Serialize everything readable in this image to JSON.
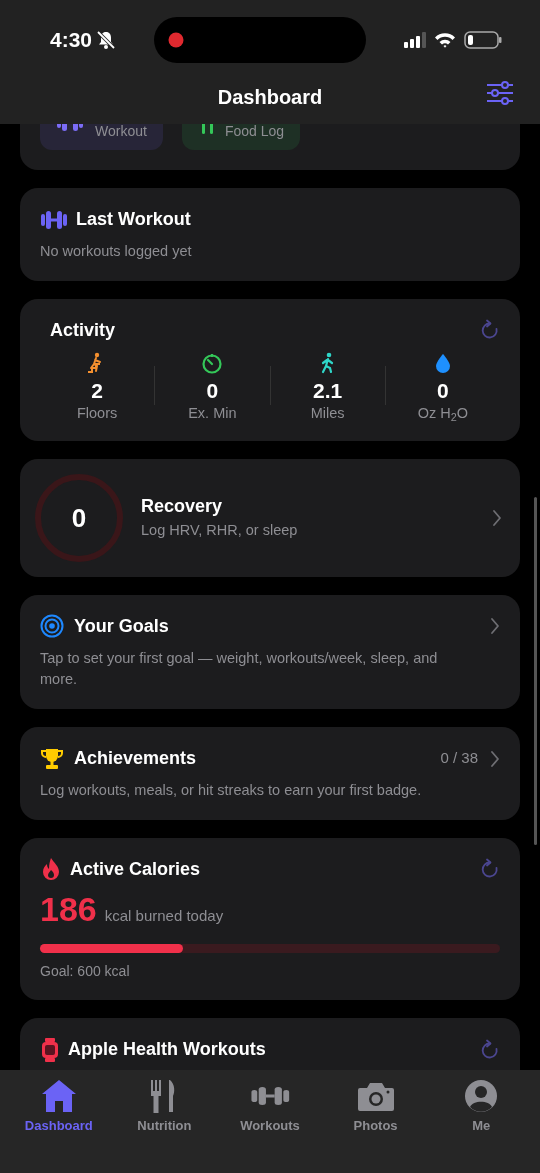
{
  "status_bar": {
    "time": "4:30"
  },
  "header": {
    "title": "Dashboard"
  },
  "quick_actions": [
    {
      "label": "Workout",
      "kind": "workout"
    },
    {
      "label": "Food Log",
      "kind": "food"
    }
  ],
  "last_workout": {
    "title": "Last Workout",
    "message": "No workouts logged yet"
  },
  "activity": {
    "title": "Activity",
    "stats": [
      {
        "kind": "floors",
        "value": "2",
        "label": "Floors"
      },
      {
        "kind": "exercise",
        "value": "0",
        "label": "Ex. Min"
      },
      {
        "kind": "distance",
        "value": "2.1",
        "label": "Miles"
      },
      {
        "kind": "water",
        "value": "0",
        "label": "Oz H$_{2}$O"
      }
    ]
  },
  "recovery": {
    "score": "0",
    "title": "Recovery",
    "subtitle": "Log HRV, RHR, or sleep"
  },
  "goals": {
    "title": "Your Goals",
    "text": "Tap to set your first goal — weight, workouts/week, sleep, and more."
  },
  "achievements": {
    "title": "Achievements",
    "progress": "0 / 38",
    "text": "Log workouts, meals, or hit streaks to earn your first badge."
  },
  "active_calories": {
    "title": "Active Calories",
    "value": "186",
    "unit": "kcal burned today",
    "level": 0.31,
    "goal": "Goal: 600 kcal"
  },
  "health_workouts": {
    "title": "Apple Health Workouts"
  },
  "tab_bar": {
    "tabs": [
      {
        "label": "Dashboard",
        "kind": "home",
        "selected": true
      },
      {
        "label": "Nutrition",
        "kind": "nutrition",
        "selected": false
      },
      {
        "label": "Workouts",
        "kind": "workouts",
        "selected": false
      },
      {
        "label": "Photos",
        "kind": "photos",
        "selected": false
      },
      {
        "label": "Me",
        "kind": "me",
        "selected": false
      }
    ]
  }
}
